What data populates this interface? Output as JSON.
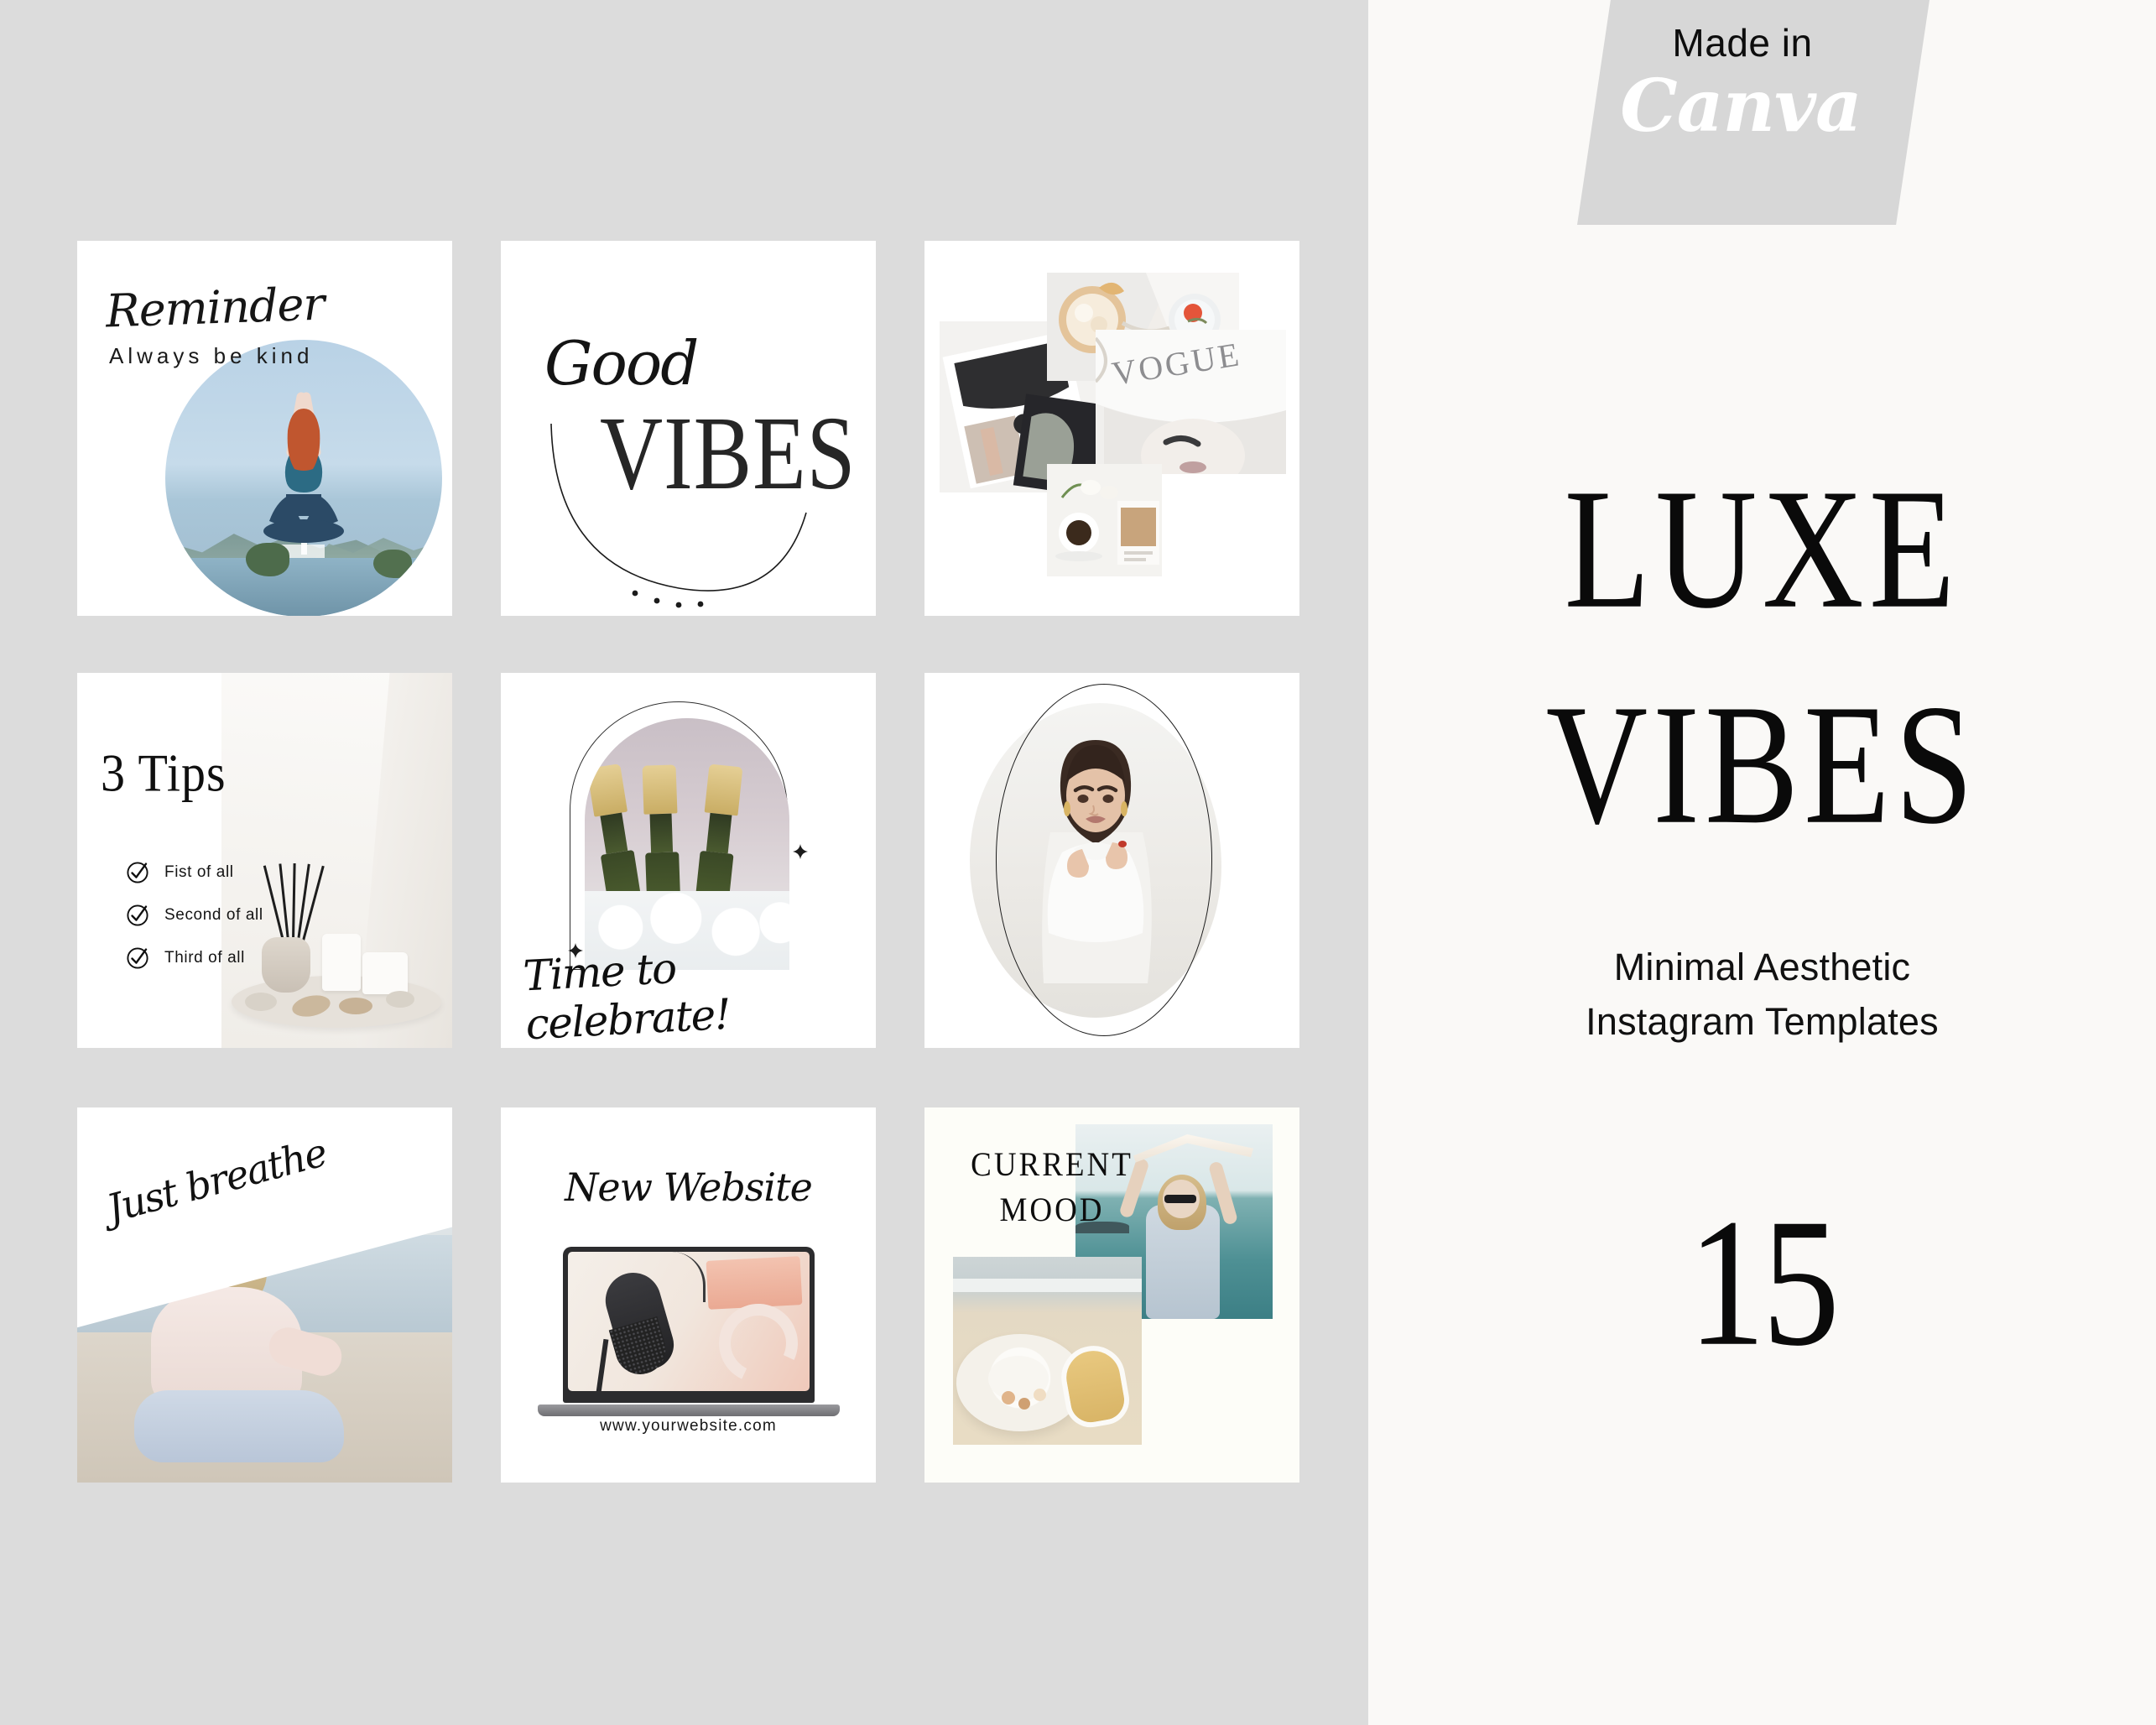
{
  "badge": {
    "made_in": "Made in",
    "brand": "Canva",
    "bg_color": "#d7d7d7"
  },
  "brand": {
    "title_line1": "LUXE",
    "title_line2": "VIBES",
    "subtitle_line1": "Minimal Aesthetic",
    "subtitle_line2": "Instagram Templates",
    "count": "15"
  },
  "colors": {
    "left_background": "#dcdcdc",
    "right_background": "#faf9f7",
    "card_background": "#ffffff",
    "text": "#0d0d0d"
  },
  "cards": [
    {
      "id": "reminder",
      "title": "Reminder",
      "subtitle": "Always be kind",
      "image_alt": "woman-doing-yoga-by-the-sea"
    },
    {
      "id": "good-vibes",
      "script_word": "Good",
      "serif_word": "VIBES",
      "decoration": "dotted-arc"
    },
    {
      "id": "vogue-collage",
      "image_alt": "vogue-magazine-flatlay-collage",
      "photo_count": "4"
    },
    {
      "id": "three-tips",
      "title": "3 Tips",
      "items": [
        "Fist of all",
        "Second of all",
        "Third of all"
      ],
      "image_alt": "reed-diffuser-and-candles"
    },
    {
      "id": "celebrate",
      "script": "Time to celebrate!",
      "image_alt": "champagne-bottles-in-ice-bucket",
      "frame": "arch"
    },
    {
      "id": "portrait",
      "image_alt": "fashion-model-in-white-blouse",
      "frame": "oval"
    },
    {
      "id": "just-breathe",
      "script": "Just breathe",
      "image_alt": "woman-sitting-on-beach"
    },
    {
      "id": "new-website",
      "script": "New Website",
      "url": "www.yourwebsite.com",
      "image_alt": "laptop-with-microphone-and-headphones"
    },
    {
      "id": "current-mood",
      "title_line1": "CURRENT",
      "title_line2": "MOOD",
      "image_alt": "beach-hat-sandals-and-woman-with-scarf"
    }
  ]
}
